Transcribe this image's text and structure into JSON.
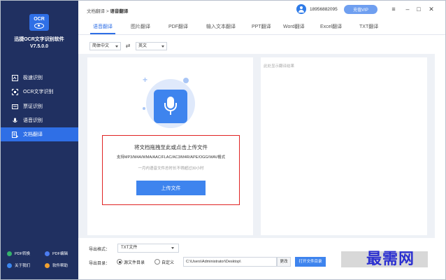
{
  "sidebar": {
    "logo_text": "OCR",
    "app_name": "迅捷OCR文字识别软件",
    "version": "V7.5.0.0",
    "nav": [
      {
        "label": "极速识别",
        "icon": "camera-icon"
      },
      {
        "label": "OCR文字识别",
        "icon": "scan-icon"
      },
      {
        "label": "票证识别",
        "icon": "ticket-icon"
      },
      {
        "label": "语音识别",
        "icon": "microphone-icon"
      },
      {
        "label": "文档翻译",
        "icon": "document-translate-icon"
      }
    ],
    "bottom": [
      {
        "label": "PDF转换",
        "color": "#34b36b"
      },
      {
        "label": "PDF编辑",
        "color": "#4c7cf0"
      },
      {
        "label": "关于我们",
        "color": "#3a86f0"
      },
      {
        "label": "软件帮助",
        "color": "#f0a030"
      }
    ]
  },
  "header": {
    "breadcrumb_parent": "文档翻译",
    "breadcrumb_sep": ">",
    "breadcrumb_current": "语音翻译",
    "phone": "18956882095",
    "vip_label": "充值VIP",
    "menu_icon": "≡",
    "minimize_icon": "–",
    "maximize_icon": "□",
    "close_icon": "✕"
  },
  "tabs": [
    "语音翻译",
    "图片翻译",
    "PDF翻译",
    "输入文本翻译",
    "PPT翻译",
    "Word翻译",
    "Excel翻译",
    "TXT翻译"
  ],
  "lang": {
    "source": "简体中文",
    "swap_icon": "⇄",
    "target": "英文"
  },
  "left_panel": {
    "title": "将文档拖拽至此或点击上传文件",
    "formats": "支持MP3/M4A/WMA/AAC/FLAC/AC3/M4R/APE/OGG/WAV格式",
    "limit": "一月内语音文件总时长不得超过30小时",
    "upload_button": "上传文件"
  },
  "right_panel": {
    "hint": "此处显示翻译结果"
  },
  "bottom": {
    "format_label": "导出格式：",
    "format_value": "TXT文件",
    "dir_label": "导出目录：",
    "radio_source": "源文件目录",
    "radio_custom": "自定义",
    "path": "C:\\Users\\Administrator\\Desktop\\",
    "change_button": "更改",
    "open_folder_button": "打开文件目录"
  },
  "watermark": "最需网"
}
